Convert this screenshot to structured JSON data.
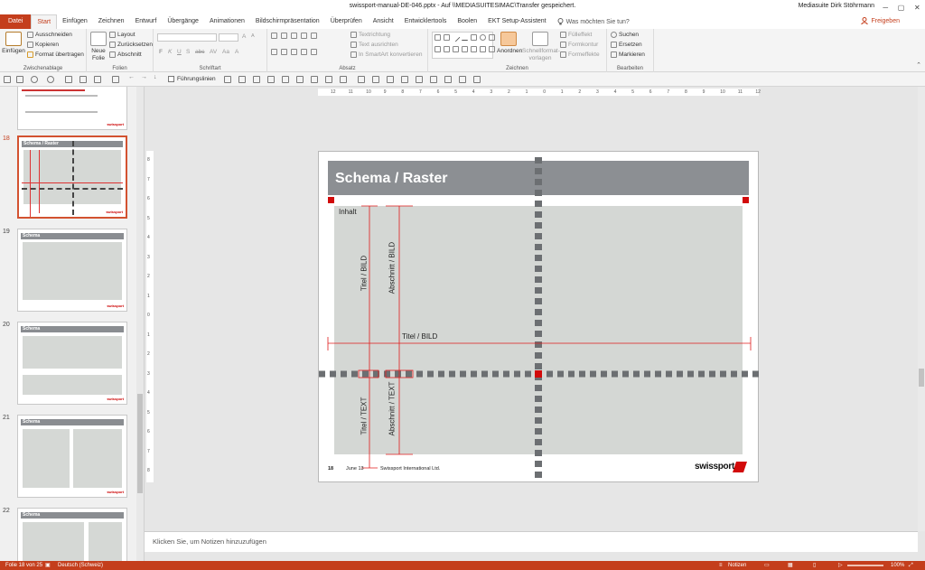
{
  "window": {
    "title": "swissport-manual-DE-046.pptx  -  Auf \\\\MEDIASUITESIMAC\\Transfer gespeichert.",
    "user": "Mediasuite Dirk Stöhrmann",
    "controls": [
      "─",
      "▢",
      "✕"
    ]
  },
  "tabs": [
    "Datei",
    "Start",
    "Einfügen",
    "Zeichnen",
    "Entwurf",
    "Übergänge",
    "Animationen",
    "Bildschirmpräsentation",
    "Überprüfen",
    "Ansicht",
    "Entwicklertools",
    "Boolen",
    "EKT Setup-Assistent"
  ],
  "tell_me": "Was möchten Sie tun?",
  "share": "Freigeben",
  "ribbon": {
    "clipboard": {
      "label": "Zwischenablage",
      "paste": "Einfügen",
      "cut": "Ausschneiden",
      "copy": "Kopieren",
      "format": "Format übertragen"
    },
    "slides": {
      "label": "Folien",
      "new": "Neue Folie",
      "layout": "Layout",
      "reset": "Zurücksetzen",
      "section": "Abschnitt"
    },
    "font": {
      "label": "Schriftart",
      "bold": "F",
      "italic": "K",
      "underline": "U",
      "strike": "S",
      "shadow": "abc",
      "spacing": "AV",
      "case": "Aa",
      "color": "A",
      "grow": "A",
      "shrink": "A"
    },
    "paragraph": {
      "label": "Absatz",
      "direction": "Textrichtung",
      "align": "Text ausrichten",
      "smartart": "In SmartArt konvertieren"
    },
    "drawing": {
      "label": "Zeichnen",
      "arrange": "Anordnen",
      "quick": "Schnellformat-vorlagen",
      "fill": "Fülleffekt",
      "outline": "Formkontur",
      "effects": "Formeffekte"
    },
    "editing": {
      "label": "Bearbeiten",
      "find": "Suchen",
      "replace": "Ersetzen",
      "select": "Markieren"
    }
  },
  "guides_label": "Führungslinien",
  "hruler": [
    "12",
    "11",
    "10",
    "9",
    "8",
    "7",
    "6",
    "5",
    "4",
    "3",
    "2",
    "1",
    "0",
    "1",
    "2",
    "3",
    "4",
    "5",
    "6",
    "7",
    "8",
    "9",
    "10",
    "11",
    "12"
  ],
  "vruler": [
    "8",
    "7",
    "6",
    "5",
    "4",
    "3",
    "2",
    "1",
    "0",
    "1",
    "2",
    "3",
    "4",
    "5",
    "6",
    "7",
    "8"
  ],
  "thumbs": [
    {
      "num": "",
      "title": "",
      "sel": false
    },
    {
      "num": "18",
      "title": "Schema / Raster",
      "sel": true
    },
    {
      "num": "19",
      "title": "Schema",
      "sel": false
    },
    {
      "num": "20",
      "title": "Schema",
      "sel": false
    },
    {
      "num": "21",
      "title": "Schema",
      "sel": false
    },
    {
      "num": "22",
      "title": "Schema",
      "sel": false
    }
  ],
  "slide": {
    "title": "Schema / Raster",
    "content_label": "Inhalt",
    "titel_bild": "Titel /  BILD",
    "abschnitt_bild": "Abschnitt /  BILD",
    "titel_bild_h": "Titel /  BILD",
    "titel_text": "Titel /  TEXT",
    "abschnitt_text": "Abschnitt /  TEXT",
    "page_number": "18",
    "date": "June 13",
    "company": "Swissport International Ltd.",
    "logo": "swissport"
  },
  "notes": "Klicken Sie, um Notizen hinzuzufügen",
  "status": {
    "slide": "Folie 18 von 25",
    "language": "Deutsch (Schweiz)",
    "notes": "Notizen",
    "zoom": "100%"
  }
}
